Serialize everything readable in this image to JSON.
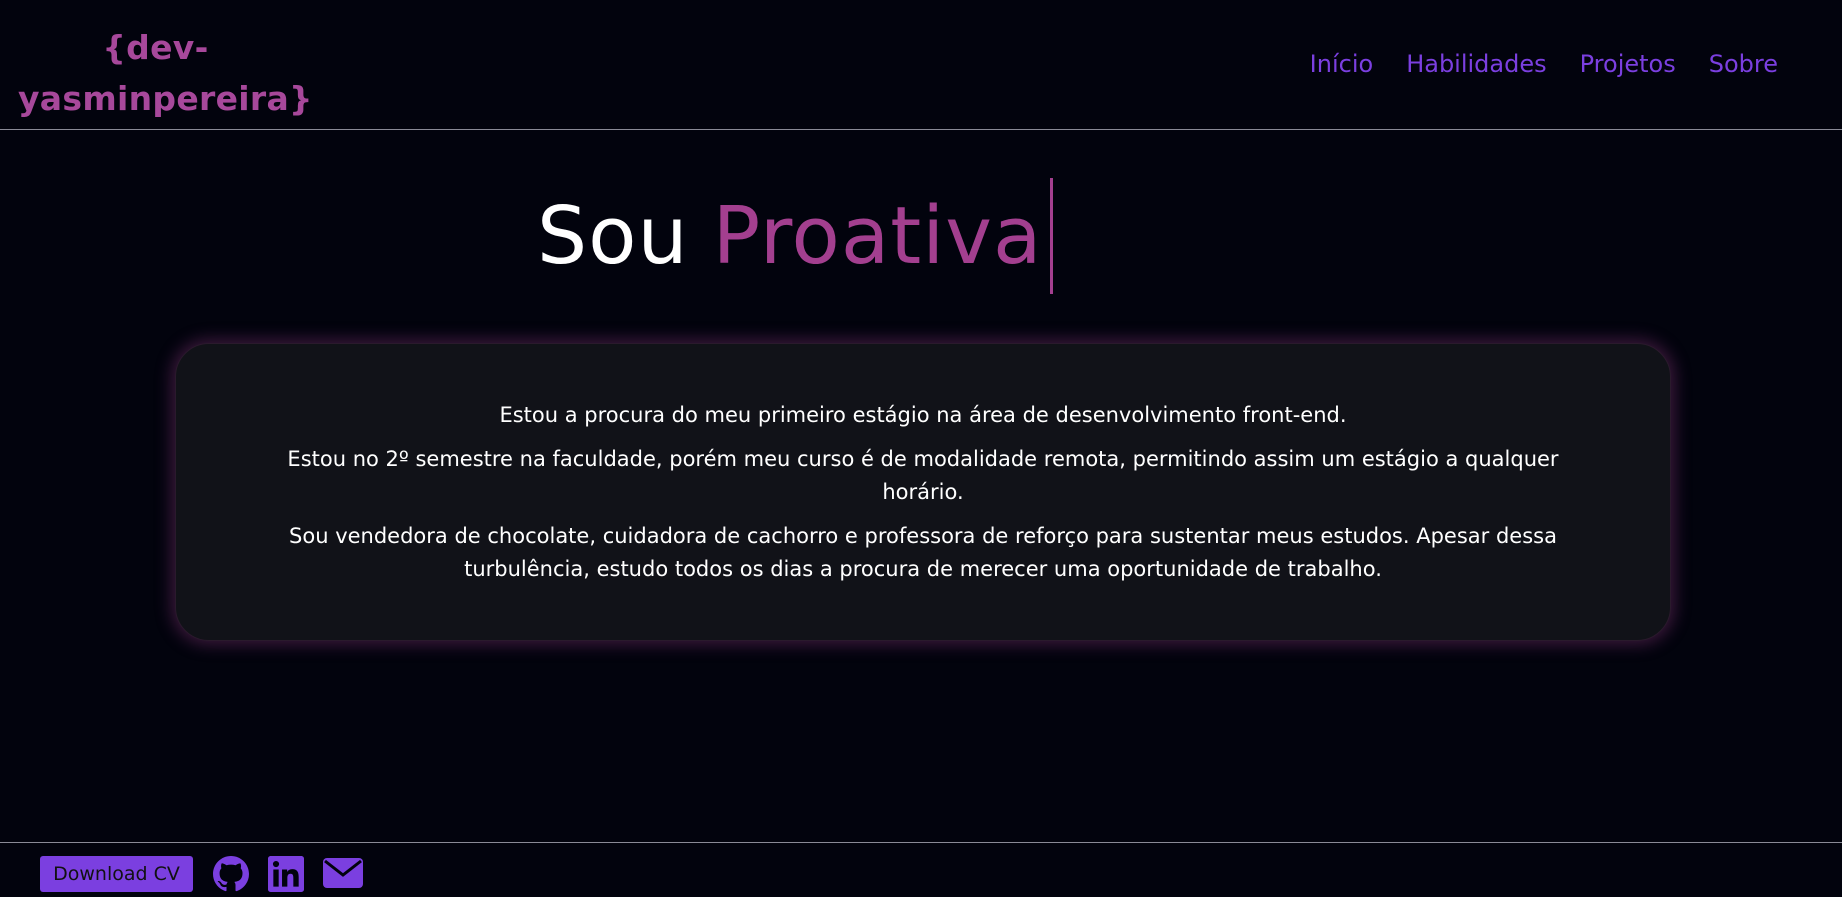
{
  "header": {
    "logo_line1": "{dev-",
    "logo_line2": "yasminpereira}",
    "nav": [
      {
        "label": "Início"
      },
      {
        "label": "Habilidades"
      },
      {
        "label": "Projetos"
      },
      {
        "label": "Sobre"
      }
    ]
  },
  "hero": {
    "static_text": "Sou",
    "typed_text": "Proativa"
  },
  "about": {
    "paragraphs": [
      "Estou a procura do meu primeiro estágio na área de desenvolvimento front-end.",
      "Estou no 2º semestre na faculdade, porém meu curso é de modalidade remota, permitindo assim um estágio a qualquer horário.",
      "Sou vendedora de chocolate, cuidadora de cachorro e professora de reforço para sustentar meus estudos. Apesar dessa turbulência, estudo todos os dias a procura de merecer uma oportunidade de trabalho."
    ]
  },
  "footer": {
    "cv_button_label": "Download CV",
    "social_icons": [
      "github-icon",
      "linkedin-icon",
      "envelope-icon"
    ]
  },
  "colors": {
    "background": "#02030d",
    "accent_pink": "#a33f8f",
    "accent_purple": "#7b3fe0",
    "card_background": "#111218"
  }
}
